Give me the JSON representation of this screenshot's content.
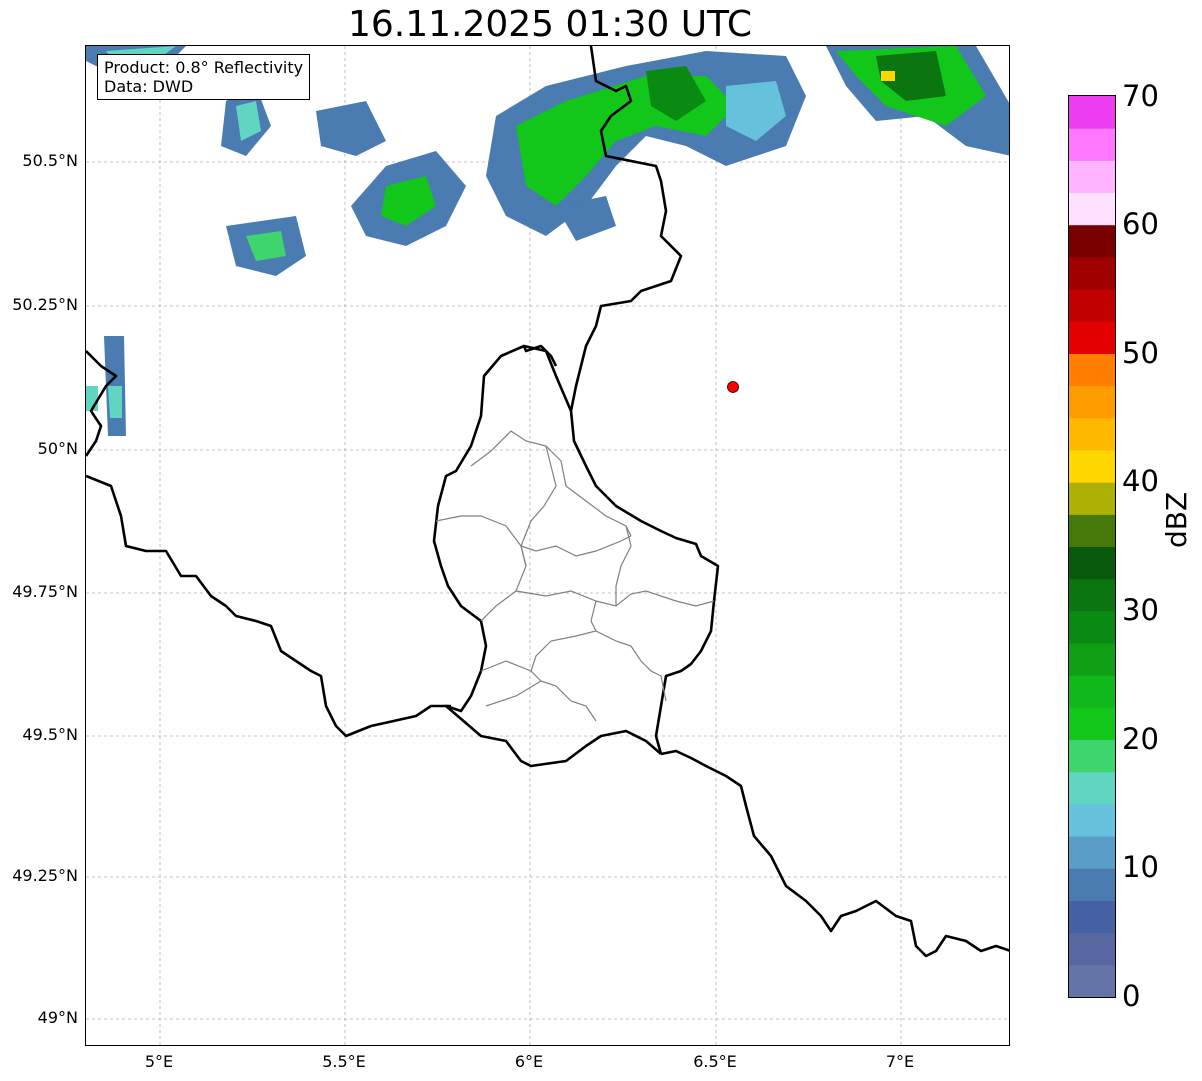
{
  "title": "16.11.2025 01:30 UTC",
  "info": {
    "product": "Product: 0.8° Reflectivity",
    "data": "Data: DWD"
  },
  "lat_ticks": [
    "50.5°N",
    "50.25°N",
    "50°N",
    "49.75°N",
    "49.5°N",
    "49.25°N",
    "49°N"
  ],
  "lon_ticks": [
    "5°E",
    "5.5°E",
    "6°E",
    "6.5°E",
    "7°E"
  ],
  "map_extent": {
    "lon_min": 4.8,
    "lon_max": 7.3,
    "lat_min": 48.95,
    "lat_max": 50.7
  },
  "marker": {
    "lon": 6.55,
    "lat": 50.11,
    "color": "#ff0000"
  },
  "colorbar": {
    "label": "dBZ",
    "min": 0,
    "max": 70,
    "ticks": [
      "0",
      "10",
      "20",
      "30",
      "40",
      "50",
      "60",
      "70"
    ],
    "colors": [
      "#6474a7",
      "#5767a0",
      "#4661a3",
      "#4a7bb1",
      "#5a9dc6",
      "#66c1dc",
      "#5fd5c2",
      "#3ed56e",
      "#12c61a",
      "#10b81b",
      "#109f14",
      "#0a8a12",
      "#0b7510",
      "#08590b",
      "#457a0b",
      "#adb105",
      "#ffd700",
      "#ffb800",
      "#ff9c00",
      "#ff7d00",
      "#e50000",
      "#c10000",
      "#a00000",
      "#7a0000",
      "#ffe0ff",
      "#ffb4ff",
      "#ff77ff",
      "#ec3cf0"
    ]
  },
  "echo_color_names": [
    "light-blue",
    "cyan",
    "green",
    "dark-green",
    "yellow"
  ]
}
